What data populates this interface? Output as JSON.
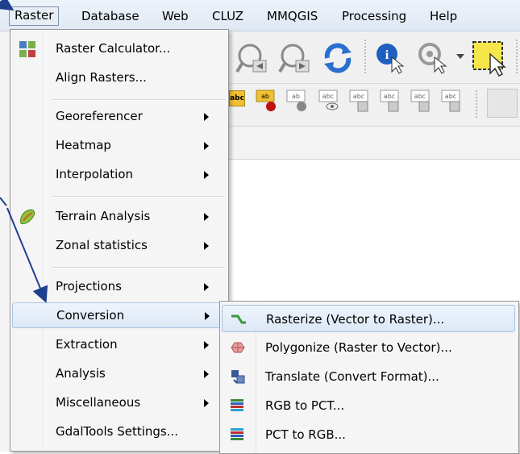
{
  "menubar": {
    "items": [
      "Raster",
      "Database",
      "Web",
      "CLUZ",
      "MMQGIS",
      "Processing",
      "Help"
    ]
  },
  "raster_menu": {
    "items": [
      {
        "label": "Raster Calculator...",
        "submenu": false,
        "icon": "raster-calculator-icon"
      },
      {
        "label": "Align Rasters...",
        "submenu": false,
        "icon": ""
      },
      {
        "label": "Georeferencer",
        "submenu": true,
        "icon": ""
      },
      {
        "label": "Heatmap",
        "submenu": true,
        "icon": ""
      },
      {
        "label": "Interpolation",
        "submenu": true,
        "icon": ""
      },
      {
        "label": "Terrain Analysis",
        "submenu": true,
        "icon": "terrain-analysis-icon"
      },
      {
        "label": "Zonal statistics",
        "submenu": true,
        "icon": ""
      },
      {
        "label": "Projections",
        "submenu": true,
        "icon": ""
      },
      {
        "label": "Conversion",
        "submenu": true,
        "icon": ""
      },
      {
        "label": "Extraction",
        "submenu": true,
        "icon": ""
      },
      {
        "label": "Analysis",
        "submenu": true,
        "icon": ""
      },
      {
        "label": "Miscellaneous",
        "submenu": true,
        "icon": ""
      },
      {
        "label": "GdalTools Settings...",
        "submenu": false,
        "icon": ""
      }
    ]
  },
  "conversion_submenu": {
    "items": [
      {
        "label": "Rasterize (Vector to Raster)...",
        "icon": "rasterize-icon"
      },
      {
        "label": "Polygonize (Raster to Vector)...",
        "icon": "polygonize-icon"
      },
      {
        "label": "Translate (Convert Format)...",
        "icon": "translate-icon"
      },
      {
        "label": "RGB to PCT...",
        "icon": "rgb-to-pct-icon"
      },
      {
        "label": "PCT to RGB...",
        "icon": "pct-to-rgb-icon"
      }
    ]
  },
  "toolbar": {
    "label_icons": [
      "abc",
      "ab",
      "ab",
      "abc",
      "abc",
      "abc",
      "abc"
    ]
  },
  "colors": {
    "highlight": "#dde8f6",
    "arrow": "#1f3f8f"
  }
}
